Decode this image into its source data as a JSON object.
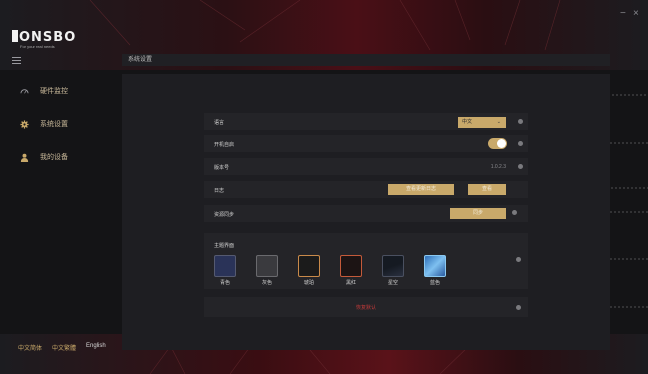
{
  "window": {
    "minimize": "−",
    "close": "×"
  },
  "logo": {
    "name": "ONSBO",
    "tagline": "For your real needs"
  },
  "sidebar": {
    "items": [
      {
        "label": "硬件监控",
        "icon": "gauge-icon"
      },
      {
        "label": "系统设置",
        "icon": "gear-icon"
      },
      {
        "label": "我的设备",
        "icon": "user-icon"
      }
    ],
    "languages": [
      "中文简体",
      "中文繁體",
      "English"
    ]
  },
  "main": {
    "header": "系统设置",
    "language": {
      "label": "语言",
      "value": "中文",
      "icon": "chevron-down-icon"
    },
    "autostart": {
      "label": "开机自启",
      "enabled": true
    },
    "version": {
      "label": "版本号",
      "value": "1.0.2.3"
    },
    "log": {
      "label": "日志",
      "view_update_log": "查看更新日志",
      "view": "查看"
    },
    "sync": {
      "label": "资源同步",
      "button": "同步"
    },
    "theme": {
      "label": "主题界面",
      "swatches": [
        {
          "name": "青色",
          "color": "#2a3358"
        },
        {
          "name": "灰色",
          "color": "#3a3a3e"
        },
        {
          "name": "琥珀",
          "color": "#1b1b1b"
        },
        {
          "name": "黑红",
          "color": "#1c1414"
        },
        {
          "name": "星空",
          "color": "#151a22"
        },
        {
          "name": "蓝色",
          "color": "#3c8bd8"
        }
      ]
    },
    "restore": {
      "label": "恢复默认"
    }
  },
  "colors": {
    "accent": "#c9a96a",
    "danger": "#c43a3a"
  }
}
